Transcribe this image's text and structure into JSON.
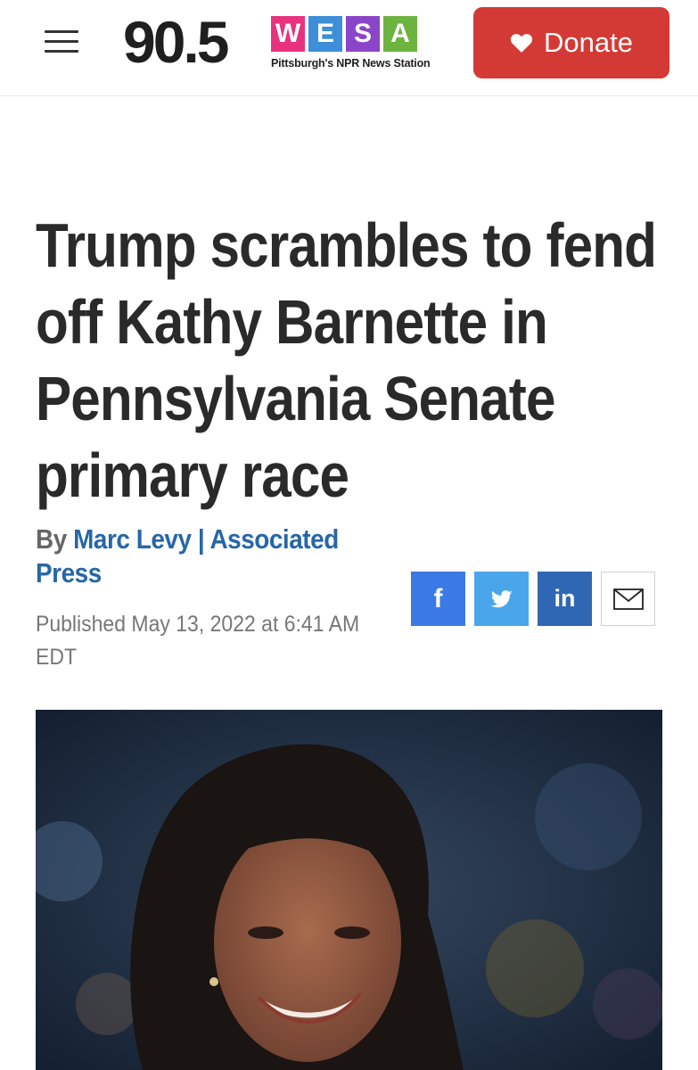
{
  "header": {
    "logo": {
      "frequency": "90.5",
      "letters": [
        {
          "char": "W",
          "color": "#e8327e"
        },
        {
          "char": "E",
          "color": "#3c8fd8"
        },
        {
          "char": "S",
          "color": "#8b45c9"
        },
        {
          "char": "A",
          "color": "#6cb33f"
        }
      ],
      "tagline": "Pittsburgh's NPR News Station"
    },
    "donate_label": "Donate",
    "donate_color": "#d43a35"
  },
  "article": {
    "headline": "Trump scrambles to fend off Kathy Barnette in Pennsylvania Senate primary race",
    "byline_prefix": "By",
    "author": "Marc Levy | Associated Press",
    "published": "Published May 13, 2022 at 6:41 AM EDT"
  },
  "share": [
    {
      "name": "facebook",
      "icon": "facebook-icon",
      "color": "#3b79e6"
    },
    {
      "name": "twitter",
      "icon": "twitter-icon",
      "color": "#4aa6ea"
    },
    {
      "name": "linkedin",
      "icon": "linkedin-icon",
      "color": "#2f67b4"
    },
    {
      "name": "email",
      "icon": "email-icon",
      "color": "#ffffff"
    }
  ]
}
